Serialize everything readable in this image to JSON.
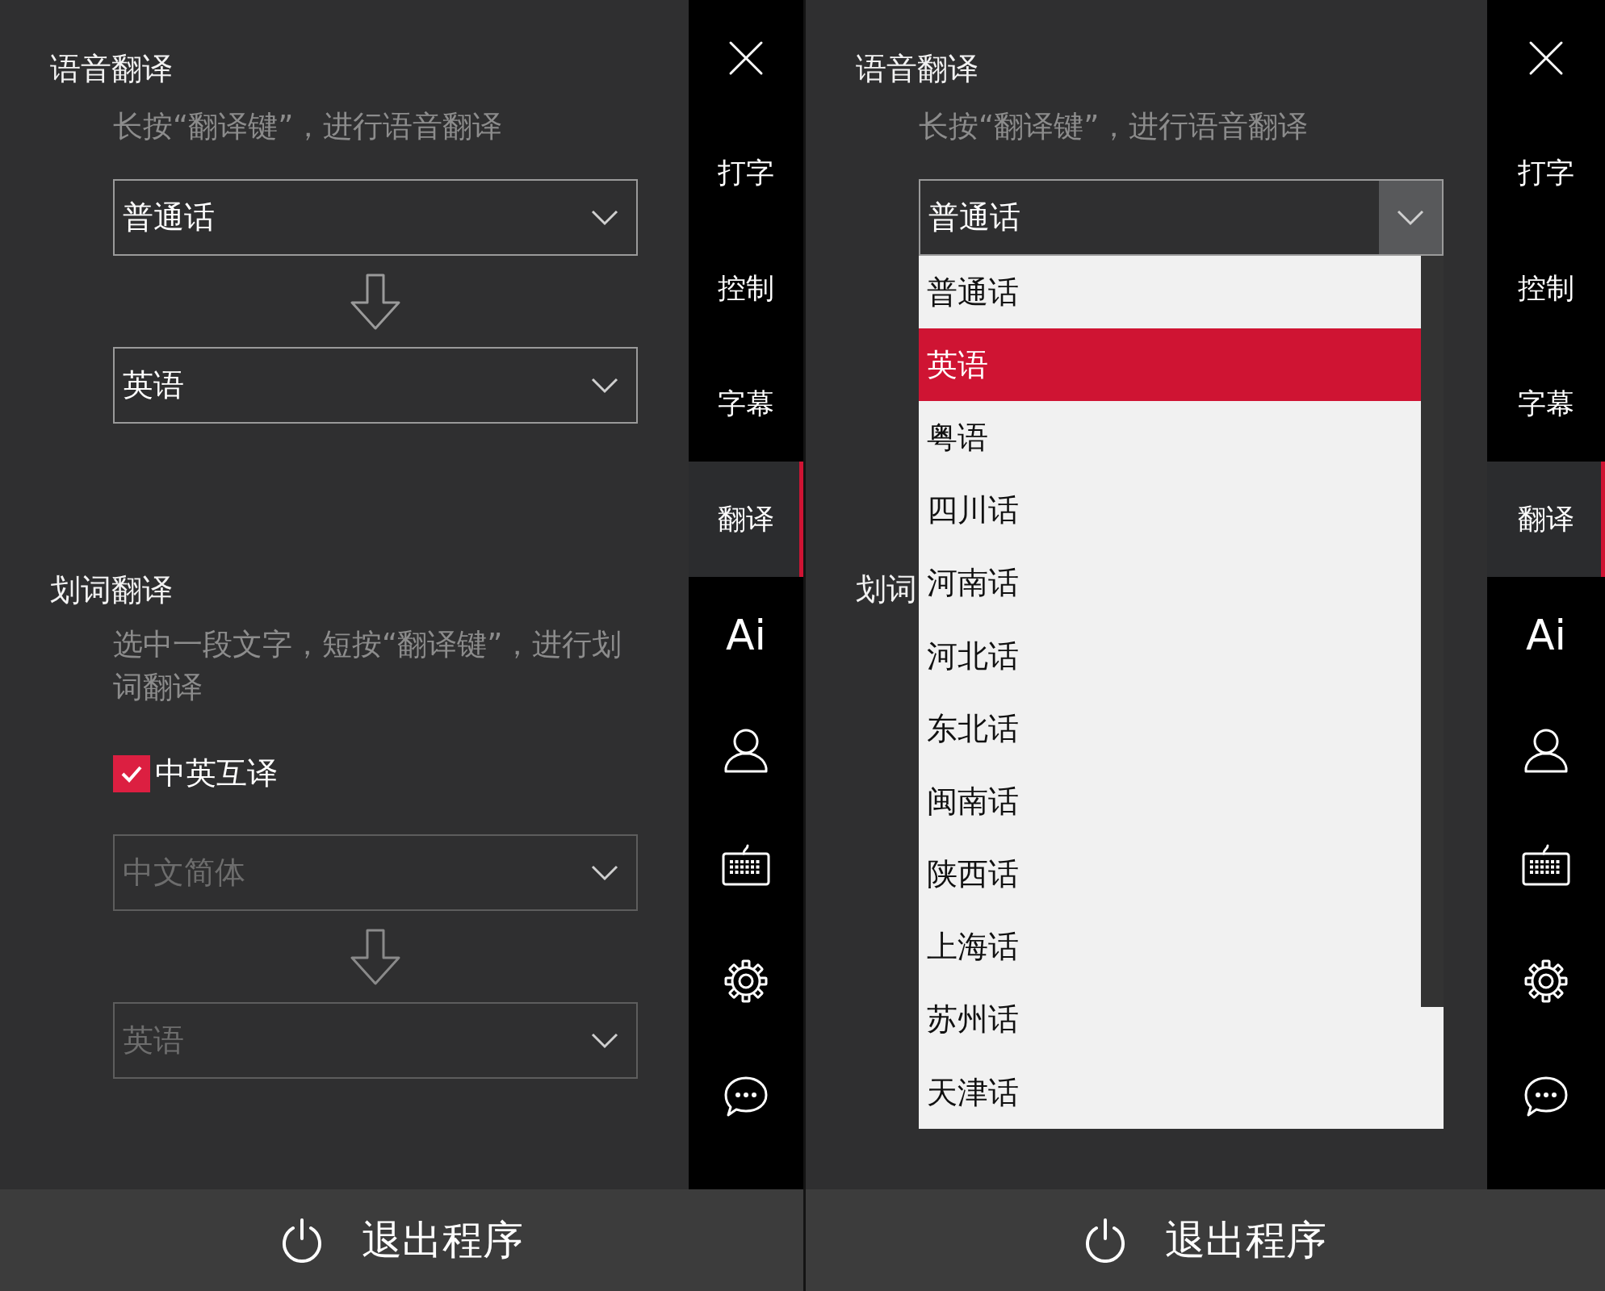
{
  "panels": [
    {
      "voice": {
        "title": "语音翻译",
        "hint": "长按“翻译键”，进行语音翻译",
        "source": {
          "value": "普通话",
          "disabled": false,
          "expanded": false
        },
        "target": {
          "value": "英语",
          "disabled": false
        }
      },
      "word": {
        "title": "划词翻译",
        "hint": "选中一段文字，短按“翻译键”，进行划词翻译",
        "option": {
          "label": "中英互译",
          "checked": true
        },
        "source": {
          "value": "中文简体",
          "disabled": true
        },
        "target": {
          "value": "英语",
          "disabled": true
        }
      },
      "sidebar": [
        {
          "kind": "close",
          "selected": false
        },
        {
          "kind": "text",
          "label": "打字",
          "selected": false
        },
        {
          "kind": "text",
          "label": "控制",
          "selected": false
        },
        {
          "kind": "text",
          "label": "字幕",
          "selected": false
        },
        {
          "kind": "text",
          "label": "翻译",
          "selected": true
        },
        {
          "kind": "text",
          "label": "Ai",
          "selected": false
        },
        {
          "kind": "user",
          "selected": false
        },
        {
          "kind": "keyboard",
          "selected": false
        },
        {
          "kind": "settings",
          "selected": false
        },
        {
          "kind": "chat",
          "selected": false
        }
      ],
      "exit": "退出程序"
    },
    {
      "voice": {
        "title": "语音翻译",
        "hint": "长按“翻译键”，进行语音翻译",
        "source": {
          "value": "普通话",
          "disabled": false,
          "expanded": true,
          "options": [
            {
              "label": "普通话",
              "highlighted": false
            },
            {
              "label": "英语",
              "highlighted": true
            },
            {
              "label": "粤语",
              "highlighted": false
            },
            {
              "label": "四川话",
              "highlighted": false
            },
            {
              "label": "河南话",
              "highlighted": false
            },
            {
              "label": "河北话",
              "highlighted": false
            },
            {
              "label": "东北话",
              "highlighted": false
            },
            {
              "label": "闽南话",
              "highlighted": false
            },
            {
              "label": "陕西话",
              "highlighted": false
            },
            {
              "label": "上海话",
              "highlighted": false
            },
            {
              "label": "苏州话",
              "highlighted": false
            },
            {
              "label": "天津话",
              "highlighted": false
            }
          ]
        }
      },
      "word": {
        "title": "划词"
      },
      "sidebar": [
        {
          "kind": "close",
          "selected": false
        },
        {
          "kind": "text",
          "label": "打字",
          "selected": false
        },
        {
          "kind": "text",
          "label": "控制",
          "selected": false
        },
        {
          "kind": "text",
          "label": "字幕",
          "selected": false
        },
        {
          "kind": "text",
          "label": "翻译",
          "selected": true
        },
        {
          "kind": "text",
          "label": "Ai",
          "selected": false
        },
        {
          "kind": "user",
          "selected": false
        },
        {
          "kind": "keyboard",
          "selected": false
        },
        {
          "kind": "settings",
          "selected": false
        },
        {
          "kind": "chat",
          "selected": false
        }
      ],
      "exit": "退出程序"
    }
  ]
}
